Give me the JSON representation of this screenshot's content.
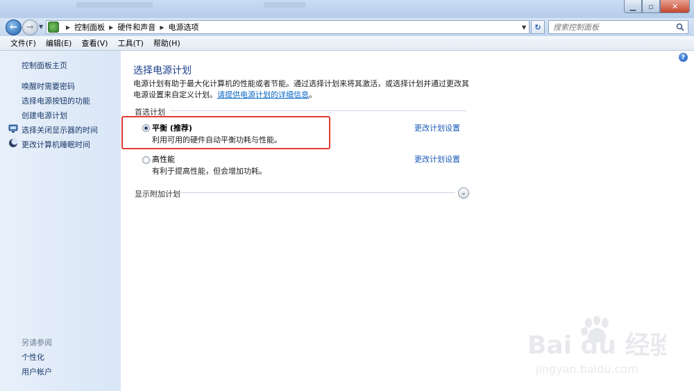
{
  "window": {
    "breadcrumbs": [
      "控制面板",
      "硬件和声音",
      "电源选项"
    ],
    "search_placeholder": "搜索控制面板"
  },
  "menu": [
    "文件(F)",
    "编辑(E)",
    "查看(V)",
    "工具(T)",
    "帮助(H)"
  ],
  "sidebar": {
    "home": "控制面板主页",
    "links": [
      "唤醒时需要密码",
      "选择电源按钮的功能",
      "创建电源计划",
      "选择关闭显示器的时间",
      "更改计算机睡眠时间"
    ],
    "see_also_heading": "另请参阅",
    "see_also": [
      "个性化",
      "用户帐户"
    ]
  },
  "main": {
    "title": "选择电源计划",
    "description": "电源计划有助于最大化计算机的性能或者节能。通过选择计划来将其激活，或选择计划并通过更改其电源设置来自定义计划。",
    "details_link": "请提供电源计划的详细信息",
    "description_end": "。",
    "preferred_plans_label": "首选计划",
    "plans": [
      {
        "name": "平衡 (推荐)",
        "desc": "利用可用的硬件自动平衡功耗与性能。",
        "link": "更改计划设置",
        "selected": true
      },
      {
        "name": "高性能",
        "desc": "有利于提高性能，但会增加功耗。",
        "link": "更改计划设置",
        "selected": false
      }
    ],
    "show_additional": "显示附加计划"
  },
  "watermark": {
    "brand": "Bai du 经验",
    "url": "jingyan.baidu.com"
  },
  "colors": {
    "accent": "#1d3f89",
    "link": "#1a58b8",
    "highlight": "#e03a32"
  }
}
